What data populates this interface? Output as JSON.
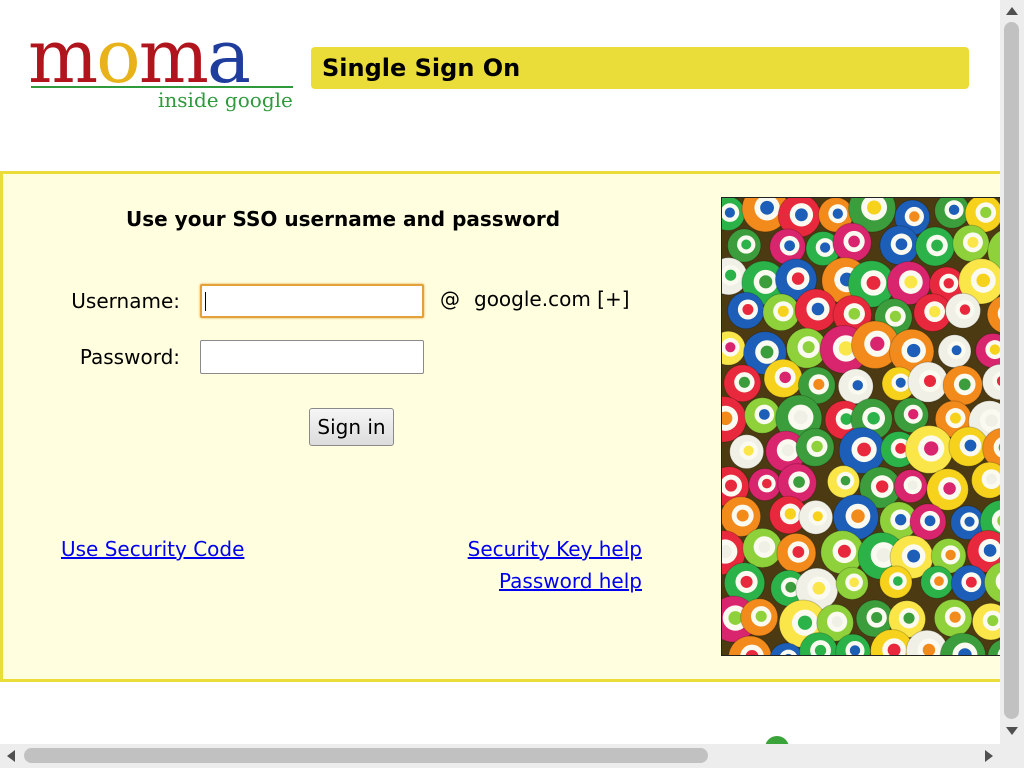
{
  "header": {
    "logo": {
      "letters": [
        {
          "char": "m",
          "color": "#b0141c"
        },
        {
          "char": "o",
          "color": "#e7b21a"
        },
        {
          "char": "m",
          "color": "#b0141c"
        },
        {
          "char": "a",
          "color": "#1f3d9c"
        }
      ],
      "tagline": "inside google"
    },
    "title": "Single Sign On"
  },
  "login": {
    "heading": "Use your SSO username and password",
    "username_label": "Username:",
    "username_value": "",
    "password_label": "Password:",
    "password_value": "",
    "domain_at": "@",
    "domain": "google.com [+]",
    "signin_label": "Sign in"
  },
  "links": {
    "security_code": "Use Security Code",
    "security_key_help": "Security Key help",
    "password_help": "Password help"
  },
  "colors": {
    "accent_yellow": "#eadd3a",
    "panel_bg": "#fffede",
    "link": "#0000ee",
    "focus_border": "#e3a13b"
  }
}
